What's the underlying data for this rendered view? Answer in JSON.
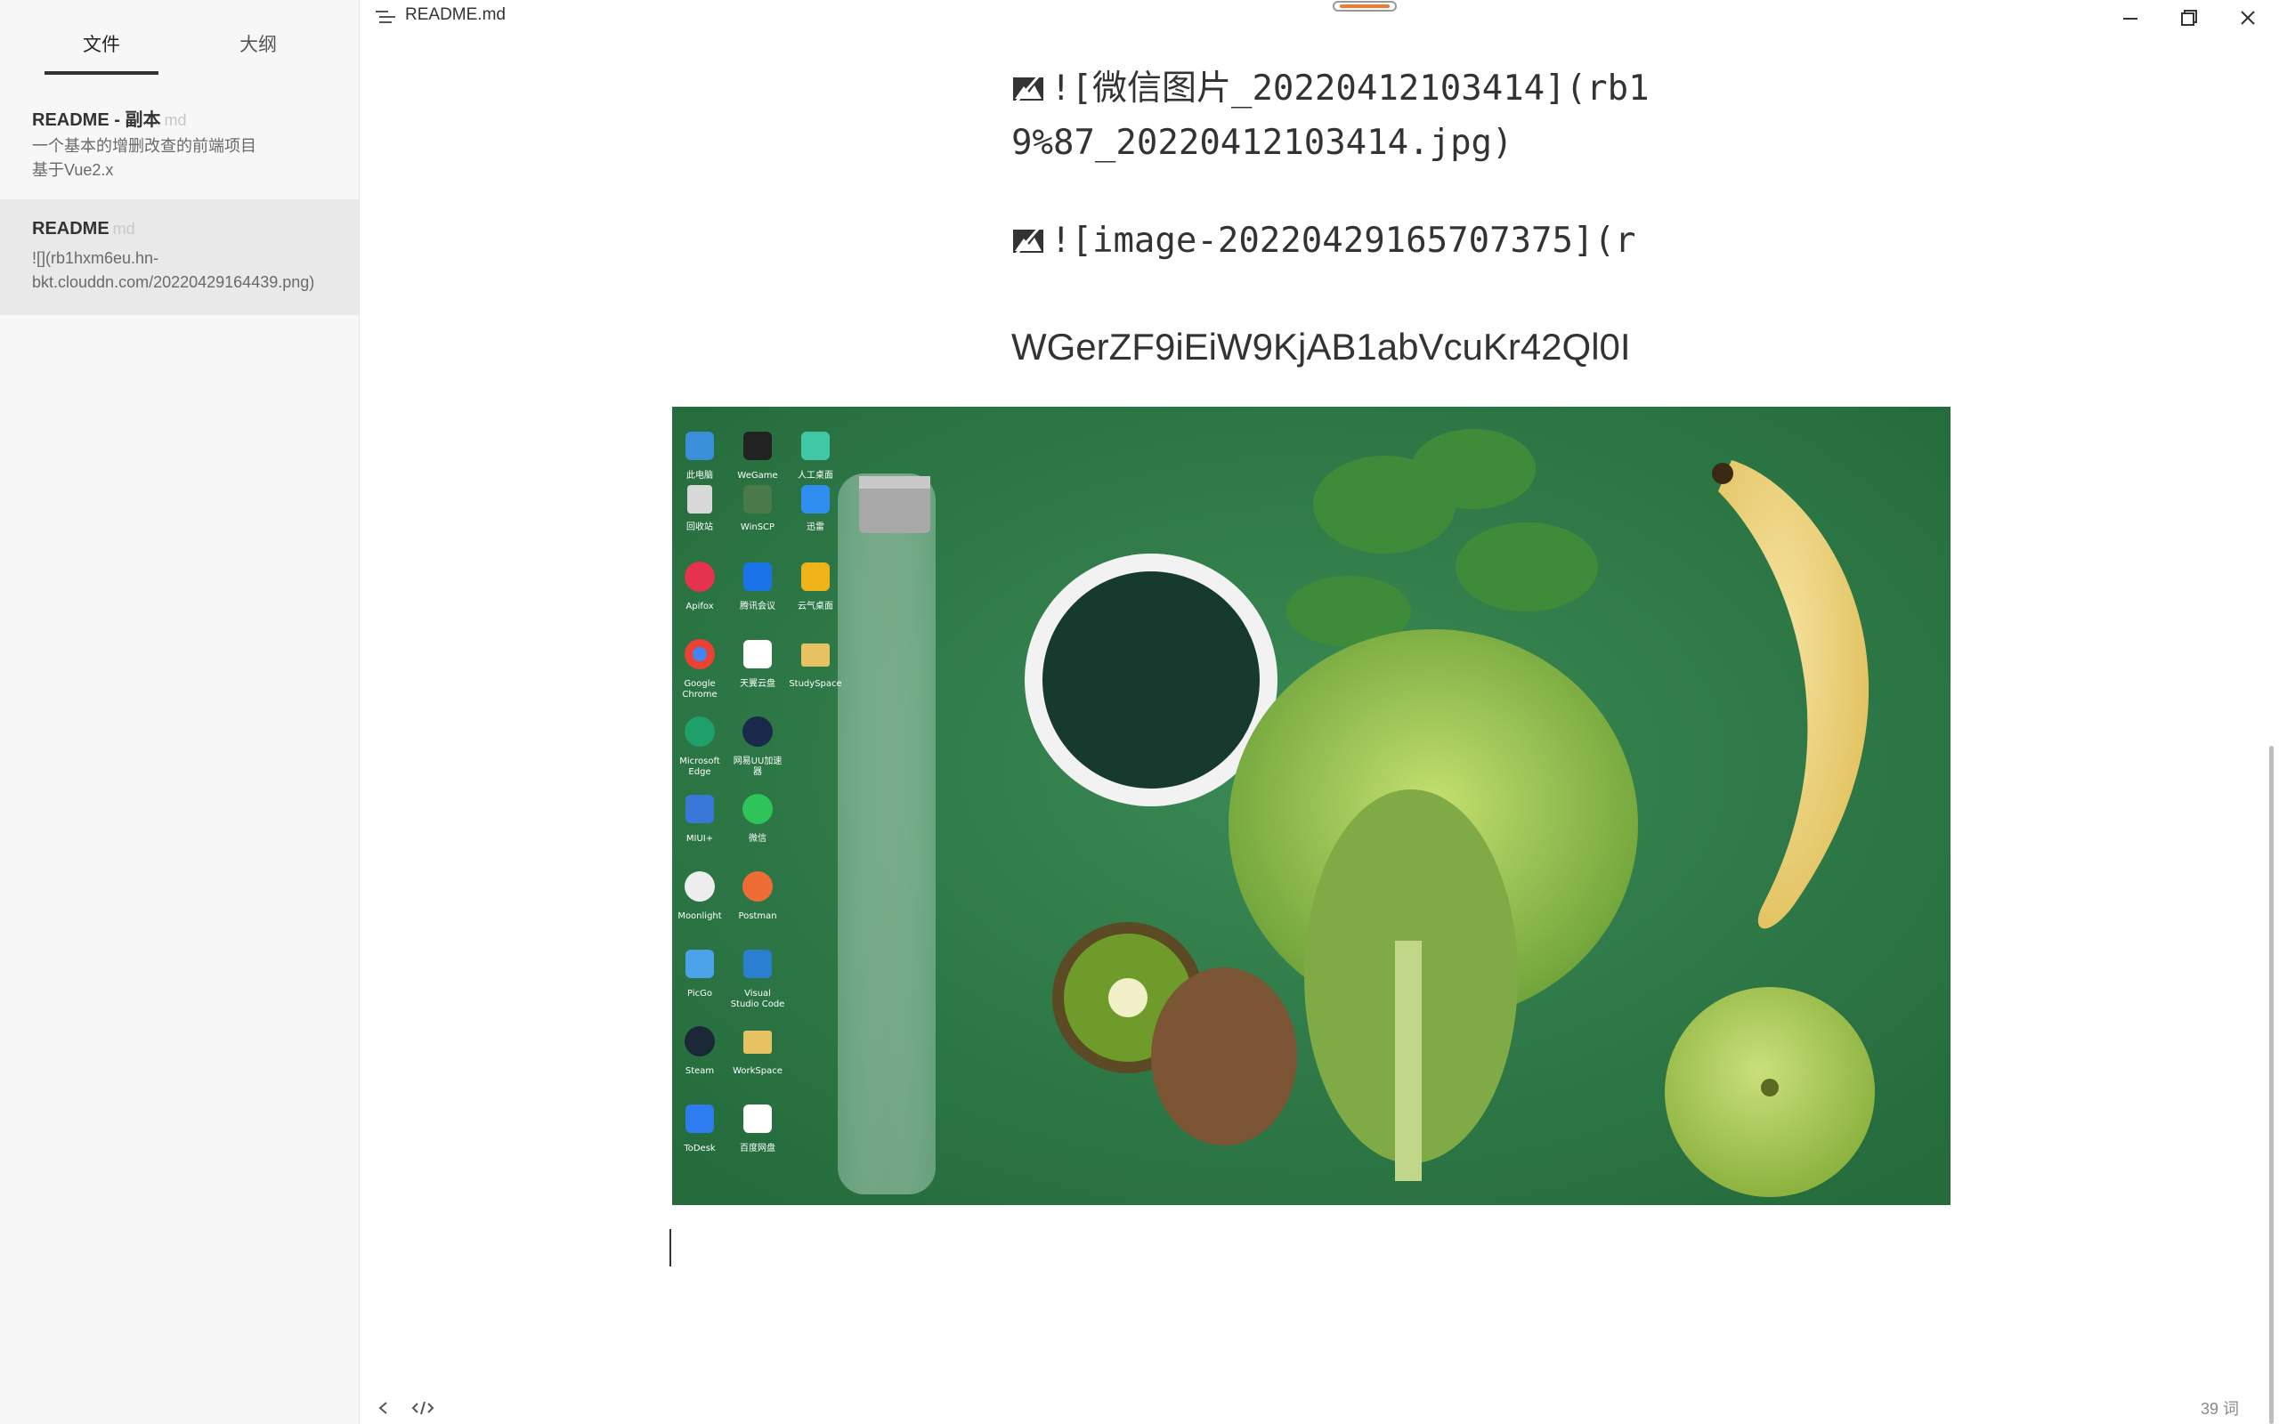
{
  "sidebar": {
    "tabs": [
      {
        "label": "文件",
        "active": true
      },
      {
        "label": "大纲",
        "active": false
      }
    ],
    "files": [
      {
        "title": "README - 副本",
        "ext": "md",
        "lines": [
          "一个基本的增删改查的前端项目",
          "基于Vue2.x"
        ],
        "selected": false
      },
      {
        "title": "README",
        "ext": "md",
        "lines": [
          "![](rb1hxm6eu.hn-",
          "bkt.clouddn.com/20220429164439.png)"
        ],
        "selected": true
      }
    ]
  },
  "titlebar": {
    "filename": "README.md",
    "controls": [
      "minimize-icon",
      "restore-icon",
      "close-icon"
    ]
  },
  "editor": {
    "lines": [
      {
        "text": "![微信图片_20220412103414](rb1",
        "broken_image": true
      },
      {
        "text": "9%87_20220412103414.jpg)",
        "broken_image": false
      },
      {
        "text": "![image-20220429165707375](r",
        "broken_image": true
      },
      {
        "text": "WGerZF9iEiW9KjAB1abVcuKr42Ql0I",
        "broken_image": false
      }
    ],
    "desktop_icons": [
      [
        "此电脑",
        "WeGame",
        "人工桌面"
      ],
      [
        "回收站",
        "WinSCP",
        "迅雷"
      ],
      [
        "Apifox",
        "腾讯会议",
        "云气桌面"
      ],
      [
        "Google Chrome",
        "天翼云盘",
        "StudySpace"
      ],
      [
        "Microsoft Edge",
        "网易UU加速器",
        ""
      ],
      [
        "MIUI+",
        "微信",
        ""
      ],
      [
        "Moonlight",
        "Postman",
        ""
      ],
      [
        "PicGo",
        "Visual Studio Code",
        ""
      ],
      [
        "Steam",
        "WorkSpace",
        ""
      ],
      [
        "ToDesk",
        "百度网盘",
        ""
      ]
    ]
  },
  "footer": {
    "word_count": "39 词"
  },
  "colors": {
    "accent": "#f07a2e",
    "wallpaper_green": "#2f7d4a"
  }
}
